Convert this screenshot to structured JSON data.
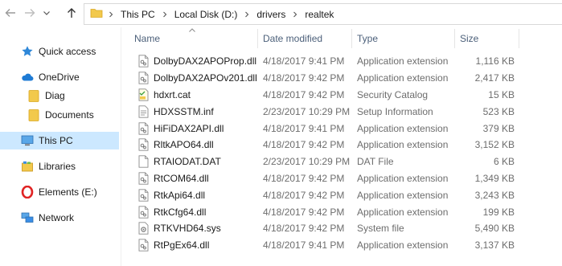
{
  "address": {
    "crumbs": [
      "This PC",
      "Local Disk (D:)",
      "drivers",
      "realtek"
    ]
  },
  "nav": {
    "items": [
      {
        "label": "Quick access",
        "icon": "star-icon"
      },
      {
        "label": "OneDrive",
        "icon": "cloud-icon"
      },
      {
        "label": "Diag",
        "icon": "folder-icon"
      },
      {
        "label": "Documents",
        "icon": "folder-icon"
      },
      {
        "label": "This PC",
        "icon": "computer-icon",
        "selected": true
      },
      {
        "label": "Libraries",
        "icon": "libraries-icon"
      },
      {
        "label": "Elements (E:)",
        "icon": "opera-drive-icon"
      },
      {
        "label": "Network",
        "icon": "network-icon"
      }
    ]
  },
  "columns": {
    "name": "Name",
    "date": "Date modified",
    "type": "Type",
    "size": "Size"
  },
  "files": [
    {
      "name": "DolbyDAX2APOProp.dll",
      "date": "4/18/2017 9:41 PM",
      "type": "Application extension",
      "size": "1,116 KB",
      "icon": "dll"
    },
    {
      "name": "DolbyDAX2APOv201.dll",
      "date": "4/18/2017 9:42 PM",
      "type": "Application extension",
      "size": "2,417 KB",
      "icon": "dll"
    },
    {
      "name": "hdxrt.cat",
      "date": "4/18/2017 9:42 PM",
      "type": "Security Catalog",
      "size": "15 KB",
      "icon": "cat"
    },
    {
      "name": "HDXSSTM.inf",
      "date": "2/23/2017 10:29 PM",
      "type": "Setup Information",
      "size": "523 KB",
      "icon": "inf"
    },
    {
      "name": "HiFiDAX2API.dll",
      "date": "4/18/2017 9:41 PM",
      "type": "Application extension",
      "size": "379 KB",
      "icon": "dll"
    },
    {
      "name": "RltkAPO64.dll",
      "date": "4/18/2017 9:42 PM",
      "type": "Application extension",
      "size": "3,152 KB",
      "icon": "dll"
    },
    {
      "name": "RTAIODAT.DAT",
      "date": "2/23/2017 10:29 PM",
      "type": "DAT File",
      "size": "6 KB",
      "icon": "dat"
    },
    {
      "name": "RtCOM64.dll",
      "date": "4/18/2017 9:42 PM",
      "type": "Application extension",
      "size": "1,349 KB",
      "icon": "dll"
    },
    {
      "name": "RtkApi64.dll",
      "date": "4/18/2017 9:42 PM",
      "type": "Application extension",
      "size": "3,243 KB",
      "icon": "dll"
    },
    {
      "name": "RtkCfg64.dll",
      "date": "4/18/2017 9:42 PM",
      "type": "Application extension",
      "size": "199 KB",
      "icon": "dll"
    },
    {
      "name": "RTKVHD64.sys",
      "date": "4/18/2017 9:42 PM",
      "type": "System file",
      "size": "5,490 KB",
      "icon": "sys"
    },
    {
      "name": "RtPgEx64.dll",
      "date": "4/18/2017 9:41 PM",
      "type": "Application extension",
      "size": "3,137 KB",
      "icon": "dll"
    }
  ],
  "colors": {
    "selected_nav": "#cce8ff",
    "header_text": "#4c607a",
    "accent_blue": "#1e7bd4",
    "folder_yellow": "#f2c94c"
  }
}
